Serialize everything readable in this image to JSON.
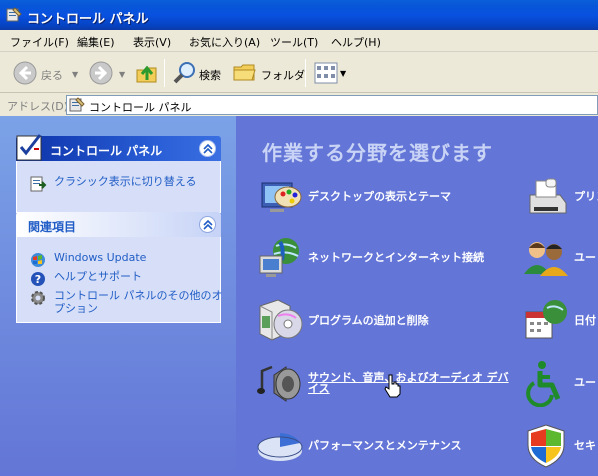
{
  "window": {
    "title": "コントロール パネル"
  },
  "menu": [
    "ファイル(F)",
    "編集(E)",
    "表示(V)",
    "お気に入り(A)",
    "ツール(T)",
    "ヘルプ(H)"
  ],
  "toolbar": {
    "back_label": "戻る",
    "search_label": "検索",
    "folders_label": "フォルダ"
  },
  "address": {
    "label": "アドレス(D)",
    "value": "コントロール パネル"
  },
  "sidebar": {
    "panel1": {
      "title": "コントロール パネル",
      "items": [
        {
          "label": "クラシック表示に切り替える",
          "icon": "switch-view-icon"
        }
      ]
    },
    "panel2": {
      "title": "関連項目",
      "items": [
        {
          "label": "Windows Update",
          "icon": "windows-update-icon"
        },
        {
          "label": "ヘルプとサポート",
          "icon": "help-icon"
        },
        {
          "label": "コントロール パネルのその他のオ",
          "label2": "プション",
          "icon": "gear-icon"
        }
      ]
    }
  },
  "main": {
    "heading": "作業する分野を選びます",
    "categories_left": [
      {
        "label": "デスクトップの表示とテーマ",
        "icon": "appearance-icon"
      },
      {
        "label": "ネットワークとインターネット接続",
        "icon": "network-icon"
      },
      {
        "label": "プログラムの追加と削除",
        "icon": "add-remove-programs-icon"
      },
      {
        "label": "サウンド、音声、およびオーディオ デバ",
        "label2": "イス",
        "icon": "sound-icon"
      },
      {
        "label": "パフォーマンスとメンテナンス",
        "icon": "performance-icon"
      }
    ],
    "categories_right": [
      {
        "label": "プリン",
        "icon": "printer-icon"
      },
      {
        "label": "ユー",
        "icon": "users-icon"
      },
      {
        "label": "日付",
        "icon": "date-time-icon"
      },
      {
        "label": "ユー",
        "icon": "accessibility-icon"
      },
      {
        "label": "セキ",
        "icon": "security-shield-icon"
      }
    ]
  },
  "colors": {
    "titlebar": "#0a5fd8",
    "sidebar": "#7ba2e7",
    "content": "#6375d6",
    "link": "#215dc6"
  }
}
